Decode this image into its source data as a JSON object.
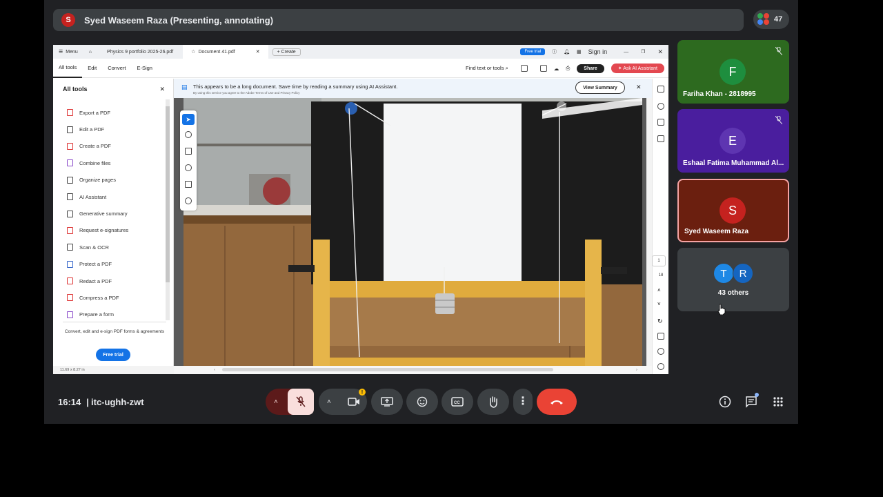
{
  "meet": {
    "presenter_label": "Syed Waseem Raza (Presenting, annotating)",
    "presenter_initial": "S",
    "participant_count": "47",
    "time": "16:14",
    "separator": "|",
    "meeting_code": "itc-ughh-zwt"
  },
  "acrobat": {
    "menu_label": "Menu",
    "tabs": [
      "Physics 9 portfolio 2025-26.pdf",
      "Document 41.pdf"
    ],
    "create_label": "Create",
    "free_trial_top": "Free trial",
    "sign_in": "Sign in",
    "menus": [
      "All tools",
      "Edit",
      "Convert",
      "E-Sign"
    ],
    "find_text": "Find text or tools",
    "share": "Share",
    "ask_ai": "Ask AI Assistant",
    "sidebar_title": "All tools",
    "sidebar_items": [
      "Export a PDF",
      "Edit a PDF",
      "Create a PDF",
      "Combine files",
      "Organize pages",
      "AI Assistant",
      "Generative summary",
      "Request e-signatures",
      "Scan & OCR",
      "Protect a PDF",
      "Redact a PDF",
      "Compress a PDF",
      "Prepare a form"
    ],
    "promo_text": "Convert, edit and e-sign PDF forms & agreements",
    "promo_button": "Free trial",
    "banner_text": "This appears to be a long document. Save time by reading a summary using AI Assistant.",
    "banner_sub": "By using this service you agree to the Adobe Terms of Use and Privacy Policy",
    "view_summary": "View Summary",
    "page_current": "1",
    "page_total": "18",
    "page_size": "11.69 x 8.27 in"
  },
  "participants": [
    {
      "name": "Fariha Khan - 2818995",
      "initial": "F",
      "color": "#1e8e3e",
      "tile_color": "#2d6a1f"
    },
    {
      "name": "Eshaal Fatima Muhammad Al...",
      "initial": "E",
      "color": "#5e35b1",
      "tile_color": "#4a1e9e"
    },
    {
      "name": "Syed Waseem Raza",
      "initial": "S",
      "color": "#c5221f",
      "tile_color": "#6b1f0f"
    }
  ],
  "others": {
    "label": "43 others",
    "initials": [
      "T",
      "R"
    ],
    "colors": [
      "#1e88e5",
      "#1565c0"
    ]
  },
  "colors": {
    "end_call": "#ea4335",
    "mic_off_bg": "#f9dedc",
    "accent_blue": "#1473e6"
  }
}
